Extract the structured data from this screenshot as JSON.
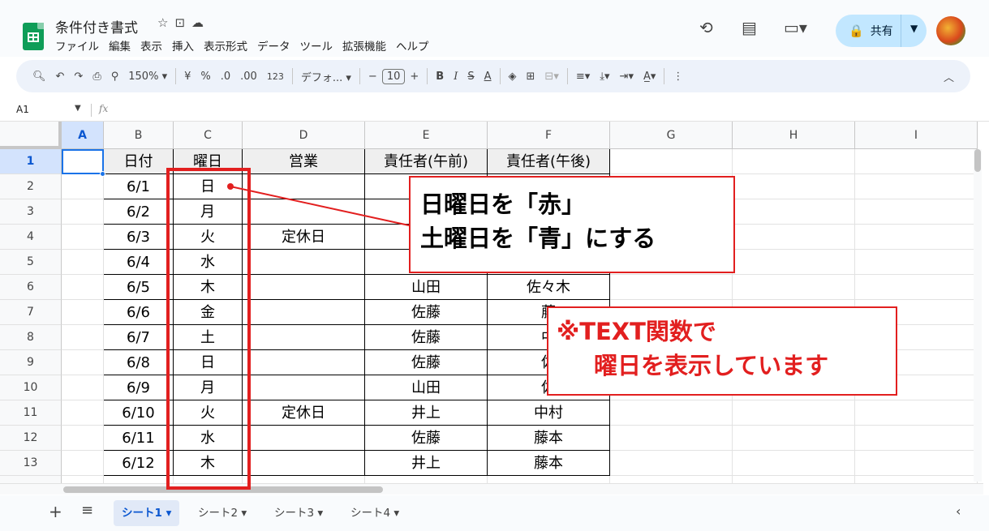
{
  "doc": {
    "title": "条件付き書式",
    "title_icons": [
      "star-icon",
      "folder-move-icon",
      "cloud-status-icon"
    ],
    "menu": [
      "ファイル",
      "編集",
      "表示",
      "挿入",
      "表示形式",
      "データ",
      "ツール",
      "拡張機能",
      "ヘルプ"
    ]
  },
  "header_right": {
    "share_label": "共有"
  },
  "toolbar": {
    "zoom": "150%",
    "currency": "¥",
    "percent": "%",
    "dec_decrease": ".0",
    "dec_increase": ".00",
    "format_123": "123",
    "font": "デフォ...",
    "minus": "−",
    "font_size": "10",
    "plus": "+",
    "bold": "B",
    "italic": "I",
    "strike": "S",
    "text_color": "A"
  },
  "formula_bar": {
    "name_box": "A1",
    "fx": "fx"
  },
  "columns": [
    "A",
    "B",
    "C",
    "D",
    "E",
    "F",
    "G",
    "H",
    "I"
  ],
  "rows": [
    "1",
    "2",
    "3",
    "4",
    "5",
    "6",
    "7",
    "8",
    "9",
    "10",
    "11",
    "12",
    "13"
  ],
  "table": {
    "headers": [
      "日付",
      "曜日",
      "営業",
      "責任者(午前)",
      "責任者(午後)"
    ],
    "body": [
      [
        "6/1",
        "日",
        "",
        "",
        ""
      ],
      [
        "6/2",
        "月",
        "",
        "",
        ""
      ],
      [
        "6/3",
        "火",
        "定休日",
        "",
        ""
      ],
      [
        "6/4",
        "水",
        "",
        "",
        ""
      ],
      [
        "6/5",
        "木",
        "",
        "山田",
        "佐々木"
      ],
      [
        "6/6",
        "金",
        "",
        "佐藤",
        "藤"
      ],
      [
        "6/7",
        "土",
        "",
        "佐藤",
        "中"
      ],
      [
        "6/8",
        "日",
        "",
        "佐藤",
        "佐"
      ],
      [
        "6/9",
        "月",
        "",
        "山田",
        "佐"
      ],
      [
        "6/10",
        "火",
        "定休日",
        "井上",
        "中村"
      ],
      [
        "6/11",
        "水",
        "",
        "佐藤",
        "藤本"
      ],
      [
        "6/12",
        "木",
        "",
        "井上",
        "藤本"
      ]
    ]
  },
  "sheets": [
    "シート1",
    "シート2",
    "シート3",
    "シート4"
  ],
  "annotations": {
    "box1_line1": "日曜日を「赤」",
    "box1_line2": "土曜日を「青」にする",
    "box2_line1": "※TEXT関数で",
    "box2_line2": "曜日を表示しています",
    "accent_color": "#e21f1f"
  }
}
